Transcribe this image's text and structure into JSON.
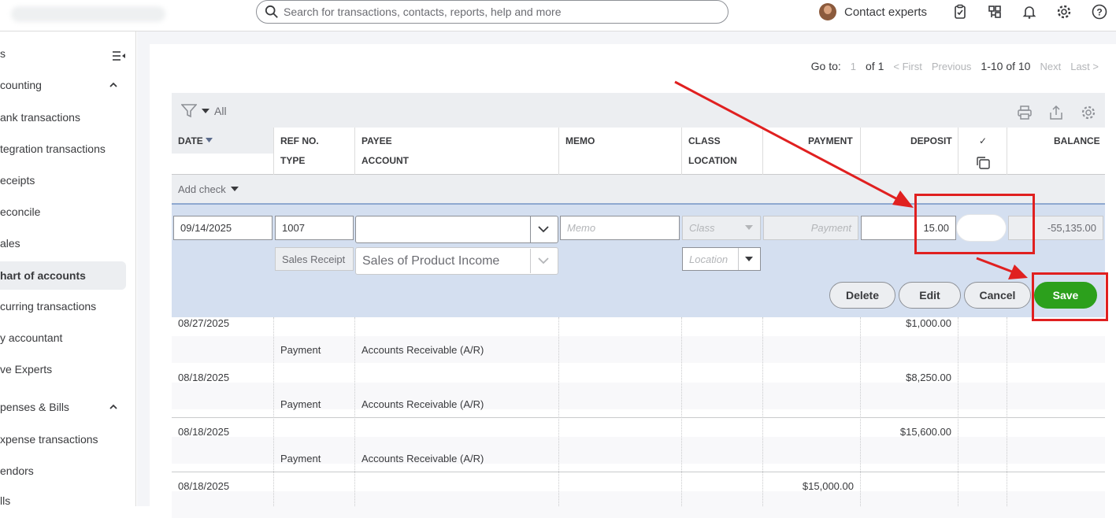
{
  "topbar": {
    "search_placeholder": "Search for transactions, contacts, reports, help and more",
    "contact_label": "Contact experts"
  },
  "sidebar": {
    "header_partial": "s",
    "accounting": "counting",
    "items": [
      "ank transactions",
      "tegration transactions",
      "eceipts",
      "econcile",
      "ales",
      "hart of accounts",
      "curring transactions",
      "y accountant",
      "ve Experts"
    ],
    "expenses": "penses & Bills",
    "exp_items": [
      "xpense transactions",
      "endors",
      "lls"
    ]
  },
  "pager": {
    "goto": "Go to:",
    "page": "1",
    "of": "of 1",
    "first": "< First",
    "previous": "Previous",
    "range": "1-10 of 10",
    "next": "Next",
    "last": "Last >"
  },
  "toolbar": {
    "filter_value": "All"
  },
  "columns": {
    "date": "DATE",
    "ref": "REF NO.",
    "type": "TYPE",
    "payee": "PAYEE",
    "account": "ACCOUNT",
    "memo": "MEMO",
    "class": "CLASS",
    "location": "LOCATION",
    "payment": "PAYMENT",
    "deposit": "DEPOSIT",
    "check": "✓",
    "balance": "BALANCE"
  },
  "add_check": "Add check",
  "edit": {
    "date": "09/14/2025",
    "ref": "1007",
    "type": "Sales Receipt",
    "account": "Sales of Product Income",
    "memo_ph": "Memo",
    "class_ph": "Class",
    "location_ph": "Location",
    "payment_ph": "Payment",
    "deposit": "15.00",
    "balance": "-55,135.00",
    "delete": "Delete",
    "edit_btn": "Edit",
    "cancel": "Cancel",
    "save": "Save"
  },
  "rows": [
    {
      "date": "08/27/2025",
      "type": "Payment",
      "account": "Accounts Receivable (A/R)",
      "payment": "",
      "deposit": "$1,000.00"
    },
    {
      "date": "08/18/2025",
      "type": "Payment",
      "account": "Accounts Receivable (A/R)",
      "payment": "",
      "deposit": "$8,250.00"
    },
    {
      "date": "08/18/2025",
      "type": "Payment",
      "account": "Accounts Receivable (A/R)",
      "payment": "",
      "deposit": "$15,600.00"
    },
    {
      "date": "08/18/2025",
      "type": "",
      "account": "",
      "payment": "$15,000.00",
      "deposit": ""
    }
  ]
}
